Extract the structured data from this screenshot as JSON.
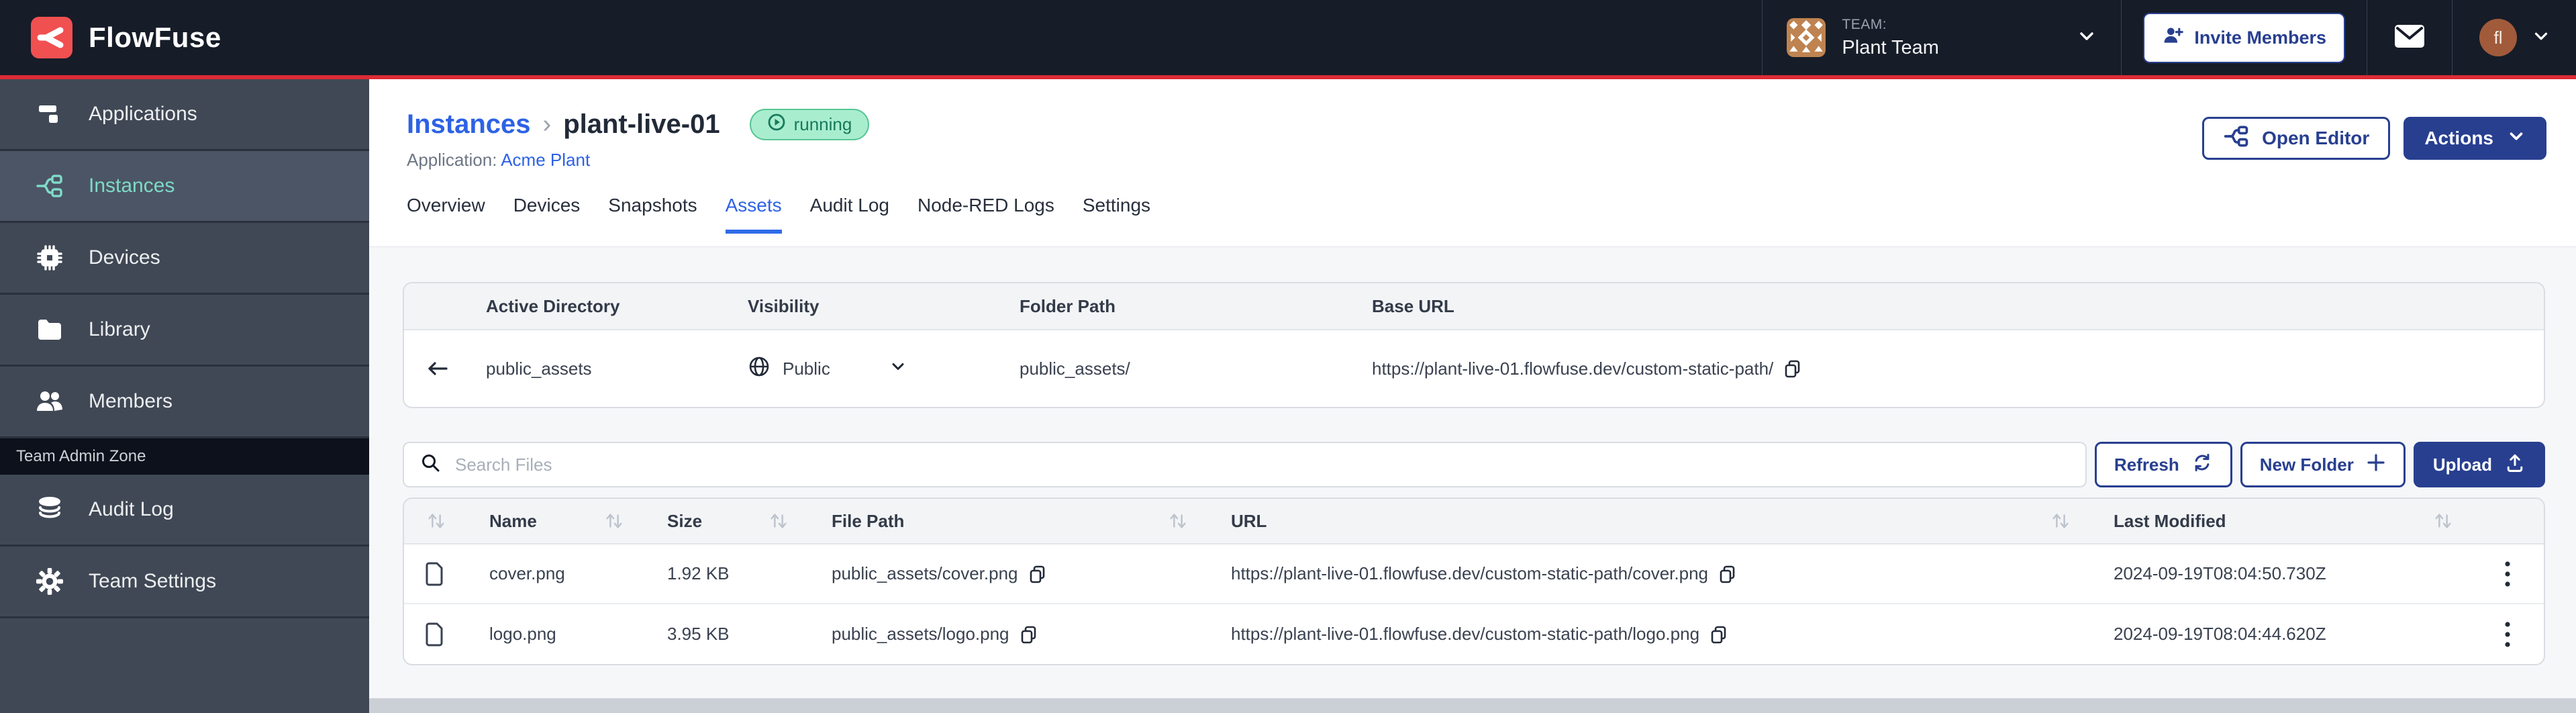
{
  "brand": {
    "name": "FlowFuse"
  },
  "header": {
    "team_kicker": "TEAM:",
    "team_name": "Plant Team",
    "invite_button": "Invite Members",
    "user_initials": "fl"
  },
  "sidebar": {
    "items": [
      {
        "label": "Applications",
        "icon": "applications-icon",
        "active": false
      },
      {
        "label": "Instances",
        "icon": "instances-icon",
        "active": true
      },
      {
        "label": "Devices",
        "icon": "devices-icon",
        "active": false
      },
      {
        "label": "Library",
        "icon": "library-icon",
        "active": false
      },
      {
        "label": "Members",
        "icon": "members-icon",
        "active": false
      }
    ],
    "admin_zone_label": "Team Admin Zone",
    "admin_items": [
      {
        "label": "Audit Log",
        "icon": "audit-log-icon"
      },
      {
        "label": "Team Settings",
        "icon": "gear-icon"
      }
    ]
  },
  "view": {
    "breadcrumb_root": "Instances",
    "breadcrumb_sep": "›",
    "instance_name": "plant-live-01",
    "status_badge": "running",
    "application_label": "Application:",
    "application_name": "Acme Plant",
    "open_editor_button": "Open Editor",
    "actions_button": "Actions",
    "tabs": [
      "Overview",
      "Devices",
      "Snapshots",
      "Assets",
      "Audit Log",
      "Node-RED Logs",
      "Settings"
    ],
    "active_tab": "Assets"
  },
  "directory": {
    "columns": [
      "Active Directory",
      "Visibility",
      "Folder Path",
      "Base URL"
    ],
    "row": {
      "name": "public_assets",
      "visibility": "Public",
      "folder_path": "public_assets/",
      "base_url": "https://plant-live-01.flowfuse.dev/custom-static-path/"
    }
  },
  "toolbar": {
    "search_placeholder": "Search Files",
    "refresh_button": "Refresh",
    "new_folder_button": "New Folder",
    "upload_button": "Upload"
  },
  "files": {
    "columns": [
      "Name",
      "Size",
      "File Path",
      "URL",
      "Last Modified"
    ],
    "rows": [
      {
        "name": "cover.png",
        "size": "1.92 KB",
        "path": "public_assets/cover.png",
        "url": "https://plant-live-01.flowfuse.dev/custom-static-path/cover.png",
        "modified": "2024-09-19T08:04:50.730Z"
      },
      {
        "name": "logo.png",
        "size": "3.95 KB",
        "path": "public_assets/logo.png",
        "url": "https://plant-live-01.flowfuse.dev/custom-static-path/logo.png",
        "modified": "2024-09-19T08:04:44.620Z"
      }
    ]
  },
  "colors": {
    "accent_red": "#DD2B35",
    "brand_red": "#F05050",
    "header_bg": "#161C28",
    "sidebar_bg": "#404855",
    "sidebar_active_bg": "#4C5565",
    "sidebar_active_text": "#7EDAC8",
    "link_blue": "#2D62E5",
    "button_navy": "#283F90",
    "badge_green_bg": "#A9EDCF",
    "badge_green_border": "#57C694",
    "badge_green_text": "#187A5B",
    "page_bg": "#F6F7F9"
  }
}
